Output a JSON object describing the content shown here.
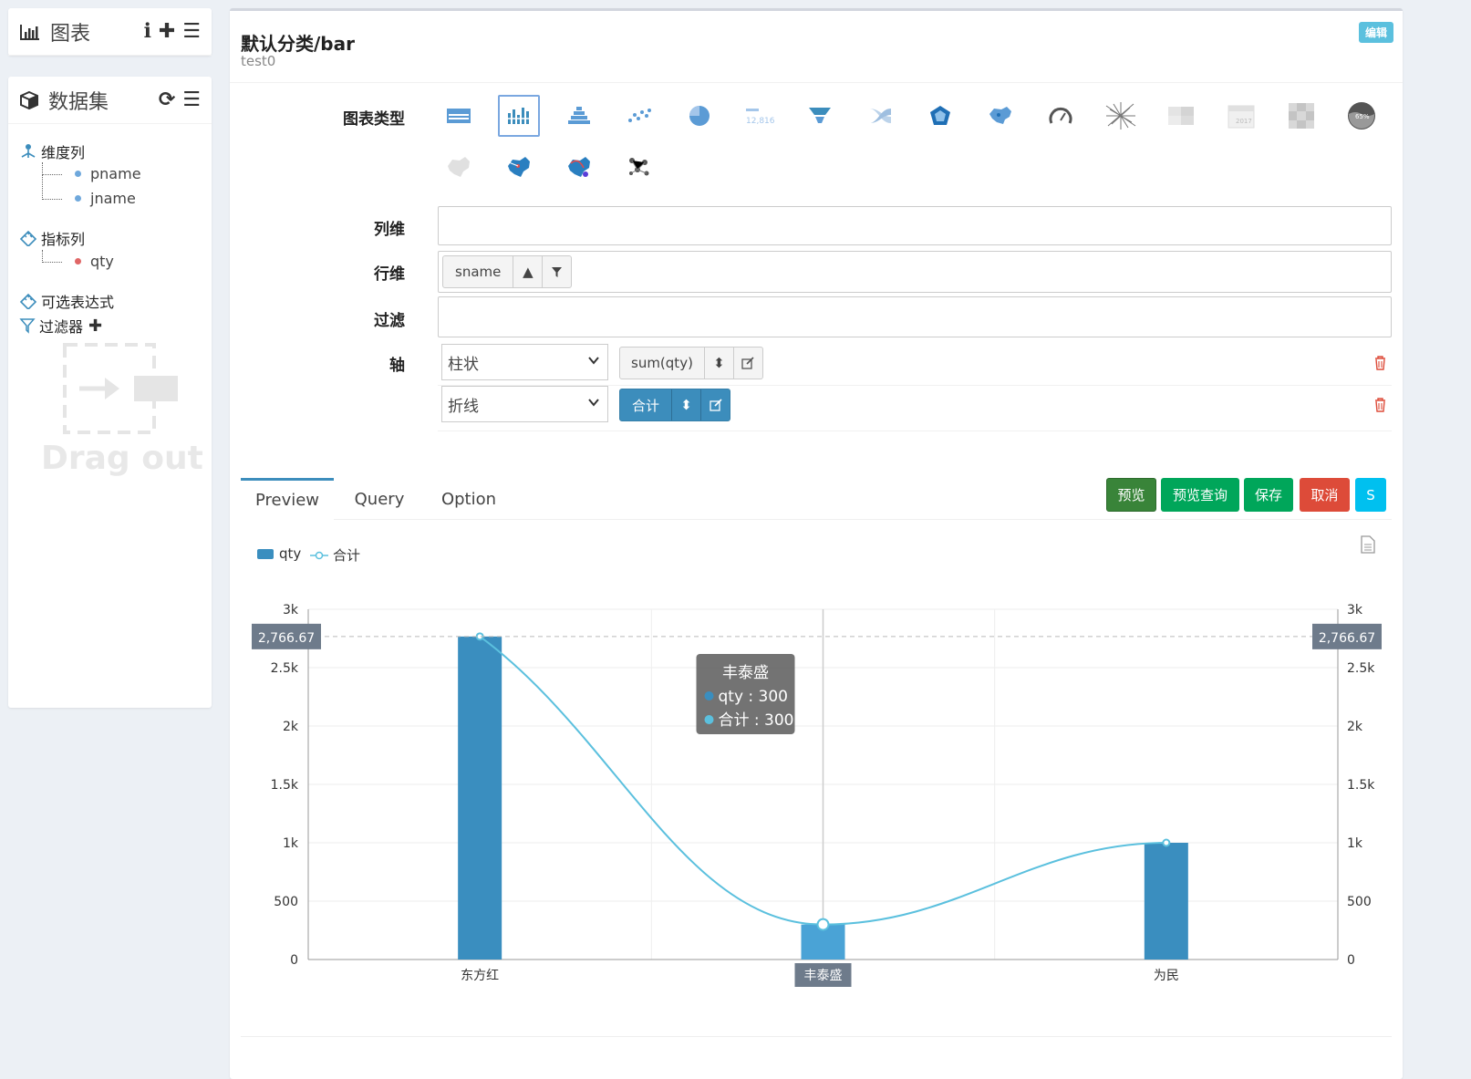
{
  "charts_panel": {
    "title": "图表"
  },
  "dataset_panel": {
    "title": "数据集",
    "dimensions_label": "维度列",
    "dimensions": [
      "pname",
      "jname"
    ],
    "measures_label": "指标列",
    "measures": [
      "qty"
    ],
    "expressions_label": "可选表达式",
    "filters_label": "过滤器",
    "drag_out": "Drag out"
  },
  "widget": {
    "title": "默认分类/bar",
    "subtitle": "test0",
    "edit_label": "编辑",
    "chart_type_label": "图表类型",
    "column_label": "列维",
    "row_label": "行维",
    "filter_label": "过滤",
    "axis_label": "轴",
    "row_field": "sname",
    "axis1_type": "柱状",
    "axis1_value": "sum(qty)",
    "axis2_type": "折线",
    "axis2_value": "合计",
    "pie_icon_text": "12,816",
    "gauge_text": "65%",
    "calendar_text": "2017"
  },
  "tabs": [
    "Preview",
    "Query",
    "Option"
  ],
  "buttons": {
    "preview": "预览",
    "preview_query": "预览查询",
    "save": "保存",
    "cancel": "取消",
    "s": "S"
  },
  "colors": {
    "bar": "#3a8ebf",
    "line": "#5bc0de",
    "primary": "#3c8dbc"
  },
  "chart_data": {
    "type": "bar",
    "categories": [
      "东方红",
      "丰泰盛",
      "为民"
    ],
    "series": [
      {
        "name": "qty",
        "type": "bar",
        "values": [
          2766.67,
          300,
          1000
        ]
      },
      {
        "name": "合计",
        "type": "line",
        "values": [
          2766.67,
          300,
          1000
        ]
      }
    ],
    "ylim": [
      0,
      3000
    ],
    "y_ticks": [
      "0",
      "500",
      "1k",
      "1.5k",
      "2k",
      "2.5k",
      "3k"
    ],
    "markline": "2,766.67",
    "tooltip": {
      "category": "丰泰盛",
      "lines": [
        "qty : 300",
        "合计 : 300"
      ]
    },
    "legend_position": "top-left"
  }
}
